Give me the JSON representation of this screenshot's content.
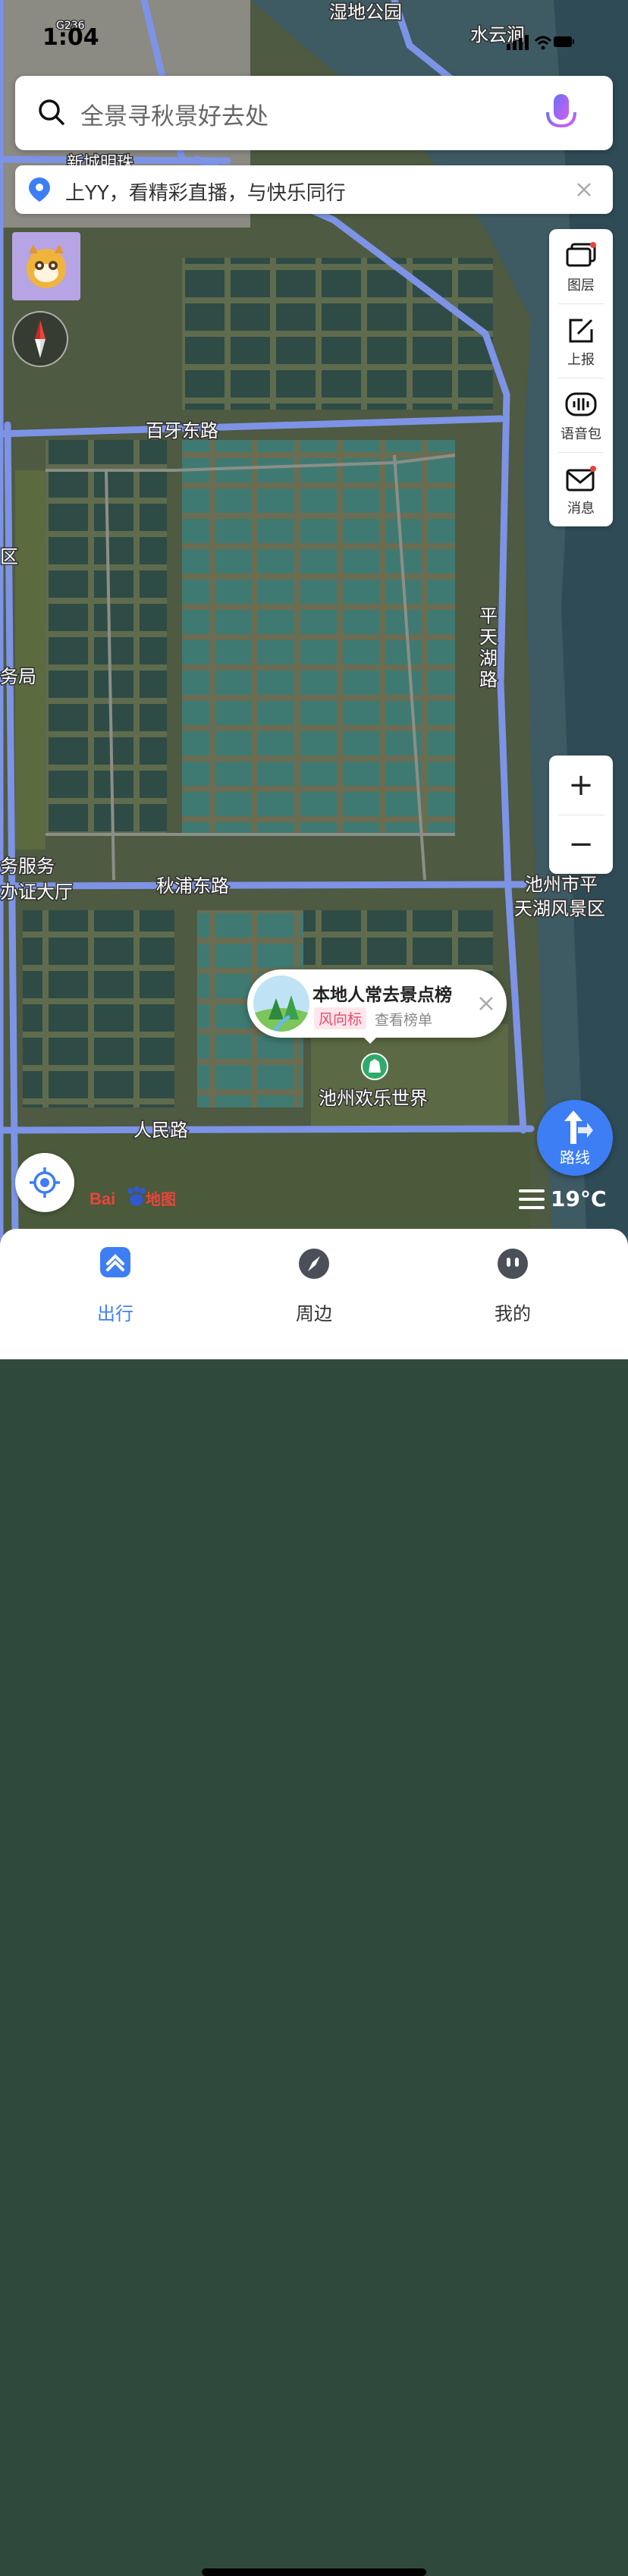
{
  "status_bar": {
    "time": "1:04"
  },
  "search": {
    "placeholder": "全景寻秋景好去处"
  },
  "notice": {
    "text": "上YY，看精彩直播，与快乐同行"
  },
  "side_panel": {
    "items": [
      {
        "label": "图层",
        "icon": "layers-icon"
      },
      {
        "label": "上报",
        "icon": "report-icon"
      },
      {
        "label": "语音包",
        "icon": "voice-pack-icon"
      },
      {
        "label": "消息",
        "icon": "message-icon"
      }
    ]
  },
  "zoom": {
    "in": "+",
    "out": "−"
  },
  "map_labels": {
    "wetland_park": "湿地公园",
    "shuiyun": "水云涧",
    "g236": "G236",
    "xincheng": "新城明珠",
    "baiya_road": "百牙东路",
    "pingtianhu_road": "平天湖路",
    "qiupu_road": "秋浦东路",
    "renmin_road": "人民路",
    "scenic_area_line1": "池州市平",
    "scenic_area_line2": "天湖风景区",
    "amusement_park": "池州欢乐世界",
    "left_qu": "区",
    "left_wuju": "务局",
    "left_service_line1": "务服务",
    "left_service_line2": "办证大厅"
  },
  "poi_card": {
    "title": "本地人常去景点榜",
    "tag": "风向标",
    "link": "查看榜单"
  },
  "route_button": {
    "label": "路线"
  },
  "weather": {
    "temperature": "19°C"
  },
  "logo": {
    "text": "Bai地图"
  },
  "tabs": [
    {
      "label": "出行",
      "active": true,
      "icon": "travel-icon"
    },
    {
      "label": "周边",
      "active": false,
      "icon": "nearby-compass-icon"
    },
    {
      "label": "我的",
      "active": false,
      "icon": "profile-icon"
    }
  ],
  "colors": {
    "accent": "#3d7ef5",
    "road": "#7d93e6"
  }
}
